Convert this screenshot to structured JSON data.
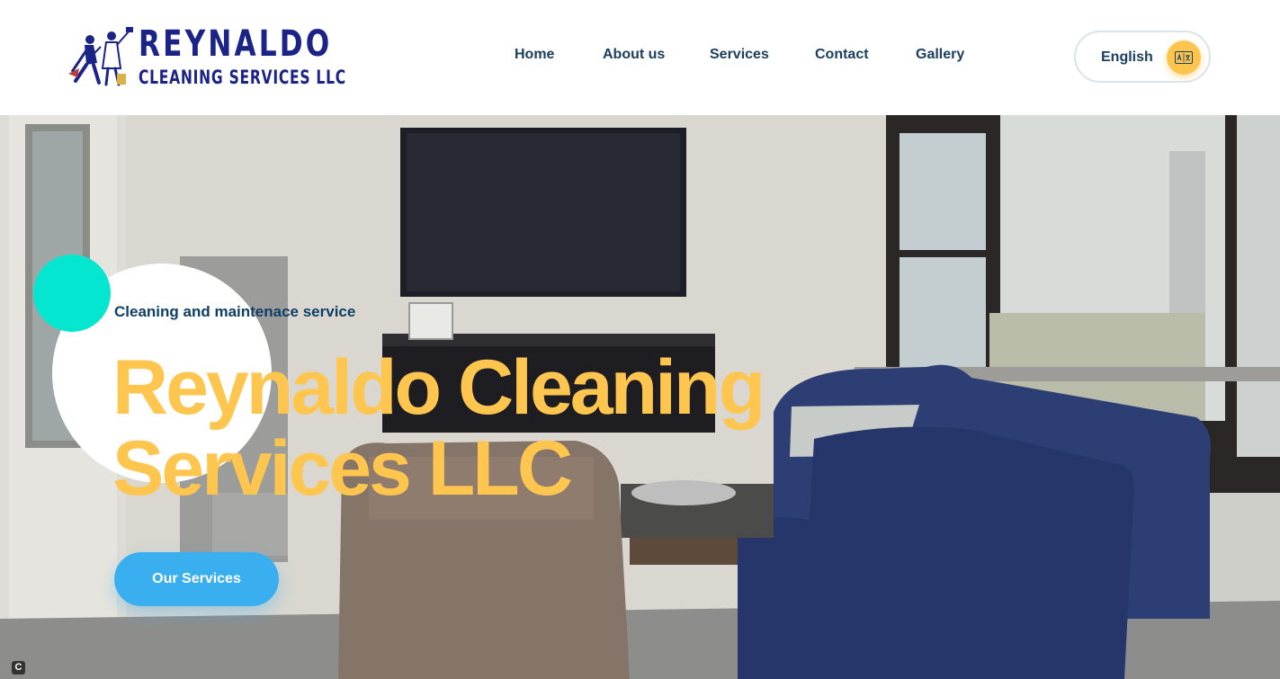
{
  "brand": {
    "name": "REYNALDO",
    "subtitle": "CLEANING SERVICES LLC",
    "color": "#1b2486"
  },
  "nav": {
    "items": [
      {
        "label": "Home"
      },
      {
        "label": "About us"
      },
      {
        "label": "Services"
      },
      {
        "label": "Contact"
      },
      {
        "label": "Gallery"
      }
    ]
  },
  "language": {
    "label": "English",
    "icon": "translate-icon",
    "accent": "#fdc54e"
  },
  "hero": {
    "tagline": "Cleaning and maintenace service",
    "title": "Reynaldo Cleaning Services LLC",
    "cta_label": "Our Services",
    "title_color": "#fec64f",
    "cta_color": "#3aaff0",
    "background": "living-room-photo"
  },
  "badge": {
    "label": "C"
  }
}
